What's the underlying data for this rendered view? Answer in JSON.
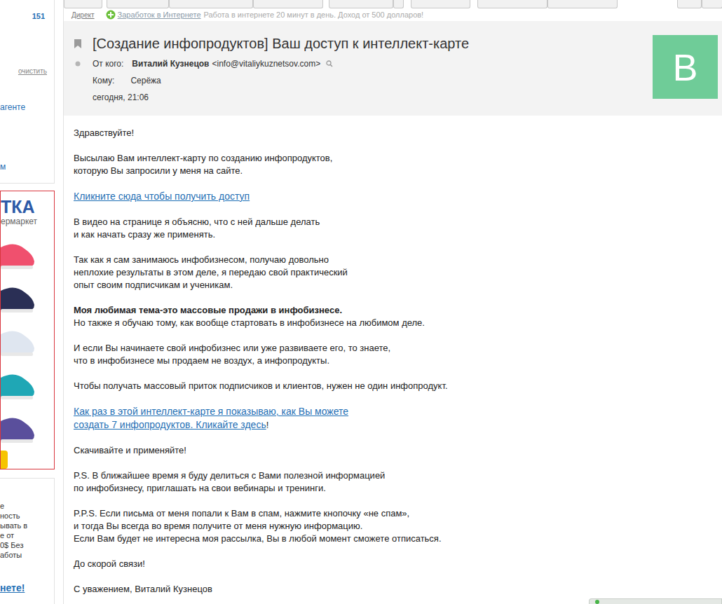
{
  "ad_line": {
    "label": "Директ",
    "link": "Заработок в Интернете",
    "text": "Работа в интернете 20 минут в день. Доход от 500 долларов!"
  },
  "sidebar": {
    "count": "151",
    "clear": "очистить",
    "agent": "агенте",
    "item": "м",
    "ad": {
      "logo": "ТКА",
      "subtitle": "ермаркет"
    },
    "promo": {
      "lines": [
        "е",
        "ность",
        "ывать в",
        "е от",
        "0$ Без",
        "аботы"
      ],
      "link": "нете!"
    }
  },
  "message": {
    "subject": "[Создание инфопродуктов] Ваш доступ к интеллект-карте",
    "from_label": "От кого:",
    "from_name": "Виталий Кузнецов",
    "from_email": "<info@vitaliykuznetsov.com>",
    "to_label": "Кому:",
    "to": "Серёжа",
    "date": "сегодня, 21:06",
    "avatar": "В"
  },
  "body": [
    [
      [
        {
          "text": "Здравствуйте!",
          "style": "normal"
        }
      ]
    ],
    [
      [
        {
          "text": "Высылаю Вам интеллект-карту по созданию инфопродуктов,",
          "style": "normal"
        }
      ],
      [
        {
          "text": "которую Вы запросили у меня на сайте.",
          "style": "normal"
        }
      ]
    ],
    [
      [
        {
          "text": "Кликните сюда чтобы получить доступ",
          "style": "link"
        }
      ]
    ],
    [
      [
        {
          "text": "В видео на странице я объясню, что с ней дальше делать",
          "style": "normal"
        }
      ],
      [
        {
          "text": "и как начать сразу же применять.",
          "style": "normal"
        }
      ]
    ],
    [
      [
        {
          "text": "Так как я сам занимаюсь инфобизнесом, получаю довольно",
          "style": "normal"
        }
      ],
      [
        {
          "text": "неплохие результаты в этом деле, я передаю свой практический",
          "style": "normal"
        }
      ],
      [
        {
          "text": "опыт своим подписчикам и ученикам.",
          "style": "normal"
        }
      ]
    ],
    [
      [
        {
          "text": "Моя любимая тема-это массовые продажи в инфобизнесе.",
          "style": "bold"
        }
      ],
      [
        {
          "text": "Но также я обучаю тому, как вообще стартовать в инфобизнесе на любимом деле.",
          "style": "normal"
        }
      ]
    ],
    [
      [
        {
          "text": "И если Вы начинаете свой инфобизнес или уже развиваете его, то знаете,",
          "style": "normal"
        }
      ],
      [
        {
          "text": "что в инфобизнесе мы продаем не воздух, а инфопродукты.",
          "style": "normal"
        }
      ]
    ],
    [
      [
        {
          "text": "Чтобы получать массовый приток подписчиков и клиентов, нужен не один инфопродукт.",
          "style": "normal"
        }
      ]
    ],
    [
      [
        {
          "text": "Как раз в этой интеллект-карте я показываю, как Вы можете",
          "style": "link"
        }
      ],
      [
        {
          "text": "создать 7 инфопродуктов. Кликайте здесь",
          "style": "link"
        },
        {
          "text": "!",
          "style": "normal"
        }
      ]
    ],
    [
      [
        {
          "text": "Скачивайте и применяйте!",
          "style": "normal"
        }
      ]
    ],
    [
      [
        {
          "text": "P.S. В ближайшее время я буду делиться с Вами полезной информацией",
          "style": "normal"
        }
      ],
      [
        {
          "text": "по инфобизнесу, приглашать на свои вебинары и тренинги.",
          "style": "normal"
        }
      ]
    ],
    [
      [
        {
          "text": "P.P.S. Если письма от меня попали к Вам в спам, нажмите кнопочку «не спам»,",
          "style": "normal"
        }
      ],
      [
        {
          "text": "и тогда Вы всегда во время получите от меня нужную информацию.",
          "style": "normal"
        }
      ],
      [
        {
          "text": "Если Вам будет не интересна моя рассылка, Вы в любой момент сможете отписаться.",
          "style": "normal"
        }
      ]
    ],
    [
      [
        {
          "text": "До скорой связи!",
          "style": "normal"
        }
      ]
    ],
    [
      [
        {
          "text": "С уважением, Виталий Кузнецов",
          "style": "normal"
        }
      ]
    ]
  ]
}
